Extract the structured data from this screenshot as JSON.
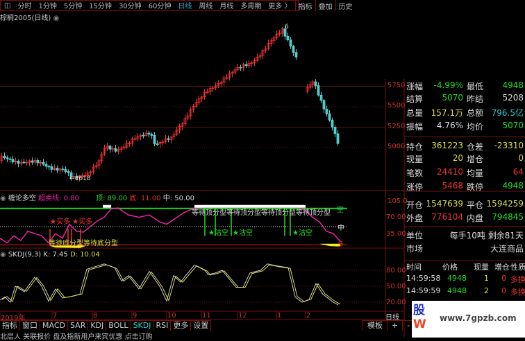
{
  "toolbar": {
    "items": [
      "分时",
      "1分钟",
      "5分钟",
      "15分钟",
      "30分钟",
      "60分钟",
      "日线",
      "周线",
      "月线",
      "多周期",
      "更多 〉"
    ],
    "active": "日线",
    "right": [
      "指标",
      "叠加",
      "历史"
    ]
  },
  "chart": {
    "title": "棕榈2005(日线)",
    "high_label": "6",
    "low_label": "←4618",
    "price_axis": [
      "5750",
      "5500",
      "5250",
      "5000"
    ],
    "price_path": [
      [
        0,
        4870
      ],
      [
        30,
        4830
      ],
      [
        60,
        4800
      ],
      [
        90,
        4720
      ],
      [
        103,
        4618
      ],
      [
        125,
        4700
      ],
      [
        140,
        4800
      ],
      [
        150,
        5000
      ],
      [
        165,
        4980
      ],
      [
        185,
        5060
      ],
      [
        215,
        5200
      ],
      [
        222,
        5050
      ],
      [
        245,
        5100
      ],
      [
        260,
        5300
      ],
      [
        275,
        5500
      ],
      [
        300,
        5700
      ],
      [
        320,
        5850
      ],
      [
        340,
        5950
      ],
      [
        360,
        6050
      ],
      [
        380,
        6200
      ],
      [
        395,
        6350
      ],
      [
        405,
        6450
      ],
      [
        415,
        6300
      ],
      [
        425,
        6100
      ],
      [
        432,
        null
      ],
      [
        440,
        5700
      ],
      [
        450,
        5820
      ],
      [
        465,
        5500
      ],
      [
        475,
        5300
      ],
      [
        487,
        4990
      ]
    ]
  },
  "indicator": {
    "name": "缠论多空",
    "param_label": "超卖线: 0.80",
    "top": "顶: 89.00",
    "bottom": "底: 11.00",
    "mid": "中: 50.00",
    "axis": [
      "105.0",
      "70.00",
      "35.00"
    ],
    "right_labels": {
      "top": "空",
      "mid": "中",
      "bottom": "多"
    },
    "annotations": {
      "buy": "★买多",
      "buy2": "★买多",
      "wait_bottom": "等待底分型等待底分型",
      "wait_top": "等待顶分型等待顶分型等待顶分型等待顶分型",
      "short1": "★沽空",
      "short2": "★沽空",
      "short3": "★沽空"
    },
    "line": [
      [
        0,
        25
      ],
      [
        10,
        15
      ],
      [
        20,
        30
      ],
      [
        30,
        20
      ],
      [
        40,
        40
      ],
      [
        50,
        35
      ],
      [
        60,
        30
      ],
      [
        70,
        15
      ],
      [
        80,
        35
      ],
      [
        90,
        25
      ],
      [
        100,
        55
      ],
      [
        110,
        40
      ],
      [
        120,
        38
      ],
      [
        130,
        50
      ],
      [
        140,
        62
      ],
      [
        150,
        70
      ],
      [
        160,
        88
      ],
      [
        170,
        90
      ],
      [
        185,
        75
      ],
      [
        200,
        70
      ],
      [
        215,
        75
      ],
      [
        230,
        60
      ],
      [
        240,
        55
      ],
      [
        250,
        65
      ],
      [
        265,
        80
      ],
      [
        280,
        90
      ],
      [
        300,
        92
      ],
      [
        350,
        92
      ],
      [
        430,
        92
      ],
      [
        440,
        85
      ],
      [
        450,
        70
      ],
      [
        460,
        60
      ],
      [
        470,
        40
      ],
      [
        480,
        35
      ],
      [
        490,
        18
      ]
    ]
  },
  "skdj": {
    "name": "SKDJ(9,3)",
    "k": "K: 7.45",
    "d": "D: 10.04",
    "axis": [
      "80.00",
      "50.00",
      "20.00"
    ],
    "k_line": [
      [
        0,
        24
      ],
      [
        7,
        30
      ],
      [
        15,
        20
      ],
      [
        22,
        50
      ],
      [
        35,
        40
      ],
      [
        50,
        67
      ],
      [
        60,
        50
      ],
      [
        70,
        22
      ],
      [
        80,
        45
      ],
      [
        90,
        28
      ],
      [
        100,
        30
      ],
      [
        115,
        35
      ],
      [
        125,
        82
      ],
      [
        150,
        92
      ],
      [
        165,
        85
      ],
      [
        175,
        60
      ],
      [
        185,
        70
      ],
      [
        200,
        45
      ],
      [
        215,
        78
      ],
      [
        230,
        50
      ],
      [
        240,
        22
      ],
      [
        250,
        70
      ],
      [
        260,
        58
      ],
      [
        280,
        90
      ],
      [
        295,
        80
      ],
      [
        300,
        72
      ],
      [
        310,
        75
      ],
      [
        320,
        80
      ],
      [
        340,
        48
      ],
      [
        350,
        48
      ],
      [
        360,
        75
      ],
      [
        375,
        80
      ],
      [
        385,
        92
      ],
      [
        400,
        88
      ],
      [
        415,
        85
      ],
      [
        425,
        30
      ],
      [
        435,
        20
      ],
      [
        445,
        25
      ],
      [
        455,
        55
      ],
      [
        465,
        35
      ],
      [
        480,
        20
      ],
      [
        487,
        15
      ]
    ]
  },
  "dates": [
    "2019年",
    "7",
    "8",
    "9",
    "10",
    "11",
    "12",
    "1",
    "2"
  ],
  "period": "日线",
  "tabs": [
    "指标",
    "窗口",
    "MACD",
    "SAR",
    "KDJ",
    "BOLL",
    "SKDJ",
    "RSI",
    "更多",
    "设置"
  ],
  "active_tab": "SKDJ",
  "tabs_right": [
    "模板",
    "+",
    "-"
  ],
  "status": "北层人  关联报价  盘及指新用户来宾优惠  点击订购",
  "quote": {
    "rows": [
      [
        "涨幅",
        "-4.99%",
        "最低",
        "4948"
      ],
      [
        "结算",
        "5070",
        "昨结",
        "5208"
      ],
      [
        "总量",
        "157.1万",
        "总额",
        "796.5亿"
      ],
      [
        "振幅",
        "4.76%",
        "均价",
        "5070"
      ],
      [
        "持仓",
        "361223",
        "仓差",
        "-23310"
      ],
      [
        "现量",
        "20",
        "增仓",
        "0"
      ],
      [
        "笔数",
        "24410",
        "均量",
        "64"
      ],
      [
        "涨停",
        "5468",
        "跌停",
        "4948"
      ],
      [
        "开仓",
        "1547639",
        "平仓",
        "1594259"
      ],
      [
        "外盘",
        "776104",
        "内盘",
        "794845"
      ]
    ],
    "unit_label": "单位",
    "unit": "每手10吨  剩余81天",
    "market_label": "市场",
    "market": "大连商品",
    "ticks_header": [
      "时间",
      "价格",
      "现量",
      "增仓",
      "性质"
    ],
    "ticks": [
      [
        "14:59:58",
        "4948",
        "1",
        "0",
        "多换"
      ],
      [
        "14:59:59",
        "4948",
        "2",
        "0",
        "多换"
      ]
    ]
  },
  "watermark": {
    "logo": "股W",
    "url": "www.7gpzb.com"
  },
  "colors": {
    "up": "#e33",
    "down": "#5cc",
    "k": "#ccccee",
    "d": "#dddd44",
    "indicator": "#e2a",
    "top_line": "#2c2"
  }
}
